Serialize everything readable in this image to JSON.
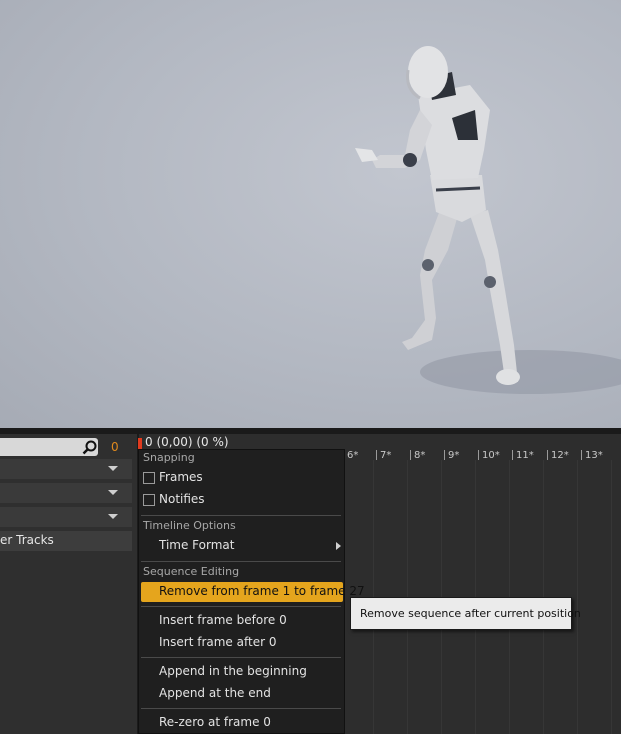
{
  "left_panel": {
    "search_placeholder": "",
    "frame_counter": "0",
    "track_label": "er Tracks"
  },
  "timeline": {
    "header_text": "0 (0,00) (0 %)",
    "ruler_ticks": [
      "6*",
      "7*",
      "8*",
      "9*",
      "10*",
      "11*",
      "12*",
      "13*"
    ]
  },
  "context_menu": {
    "snapping": {
      "heading": "Snapping",
      "frames_label": "Frames",
      "frames_checked": false,
      "notifies_label": "Notifies",
      "notifies_checked": false
    },
    "timeline_options": {
      "heading": "Timeline Options",
      "time_format_label": "Time Format"
    },
    "sequence_editing": {
      "heading": "Sequence Editing",
      "items": [
        "Remove from frame 1 to frame 27",
        "Insert frame before 0",
        "Insert frame after 0",
        "Append in the beginning",
        "Append at the end",
        "Re-zero at frame 0"
      ]
    }
  },
  "tooltip": {
    "text": "Remove sequence after current position"
  },
  "colors": {
    "highlight": "#e5a51d",
    "frame_counter": "#e08a1e",
    "playhead": "#e03a1e"
  }
}
